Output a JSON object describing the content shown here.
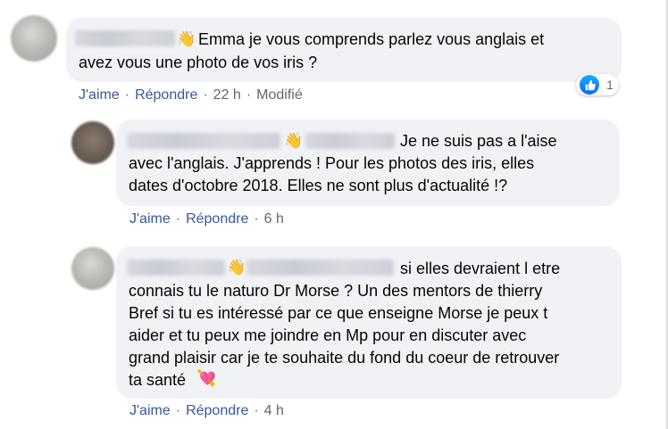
{
  "comments": [
    {
      "text_lines": [
        "Emma je vous comprends parlez vous anglais et",
        "avez vous une photo de vos iris ?"
      ],
      "like_label": "J'aime",
      "reply_label": "Répondre",
      "time": "22 h",
      "edited_label": "Modifié",
      "reaction": {
        "icon": "thumbs-up-icon",
        "count": "1",
        "color": "#0866ff"
      }
    },
    {
      "text_lines": [
        "Je ne suis pas a l'aise",
        "avec l'anglais. J'apprends ! Pour les photos des iris, elles",
        "dates d'octobre 2018. Elles ne sont plus d'actualité !?"
      ],
      "like_label": "J'aime",
      "reply_label": "Répondre",
      "time": "6 h"
    },
    {
      "text_lines": [
        "si elles devraient l etre",
        "connais tu le naturo Dr Morse ? Un des mentors de thierry",
        "Bref si tu es intéressé par ce que enseigne Morse je peux t",
        "aider et tu peux me joindre en Mp pour en discuter avec",
        "grand plaisir car je te souhaite du fond du coeur de retrouver",
        "ta santé"
      ],
      "emoji": "heart-with-arrow-icon",
      "like_label": "J'aime",
      "reply_label": "Répondre",
      "time": "4 h"
    }
  ],
  "icons": {
    "wave": "waving-hand-icon"
  },
  "colors": {
    "bubble": "#f0f2f5",
    "link": "#385898",
    "meta": "#65676b"
  }
}
